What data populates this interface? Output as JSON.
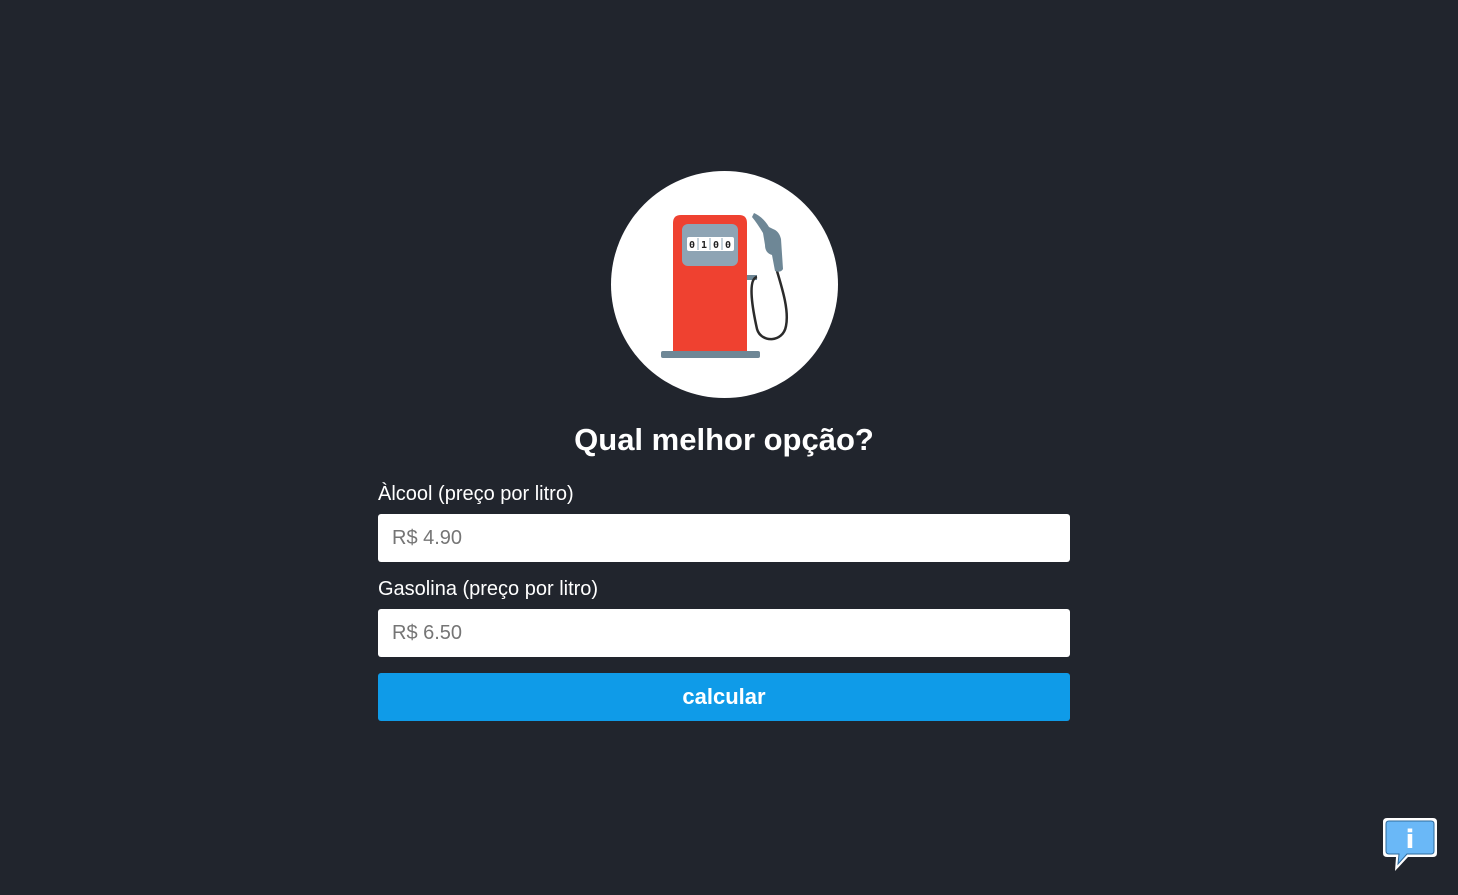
{
  "logo": {
    "icon": "fuel-pump-icon",
    "display_digits": [
      "0",
      "1",
      "0",
      "0"
    ],
    "colors": {
      "pump_body": "#ef4130",
      "display": "#8ea4b4",
      "base": "#6e8796",
      "hose": "#2b2b2b"
    }
  },
  "title": "Qual melhor opção?",
  "form": {
    "alcool": {
      "label": "Àlcool (preço por litro)",
      "placeholder": "R$ 4.90",
      "value": ""
    },
    "gasolina": {
      "label": "Gasolina (preço por litro)",
      "placeholder": "R$ 6.50",
      "value": ""
    },
    "submit_label": "calcular"
  },
  "info_button": {
    "icon": "info-speech-bubble-icon",
    "glyph": "i"
  },
  "colors": {
    "background": "#21252d",
    "accent": "#0f9be8",
    "info_bubble": "#6ab8f7"
  }
}
